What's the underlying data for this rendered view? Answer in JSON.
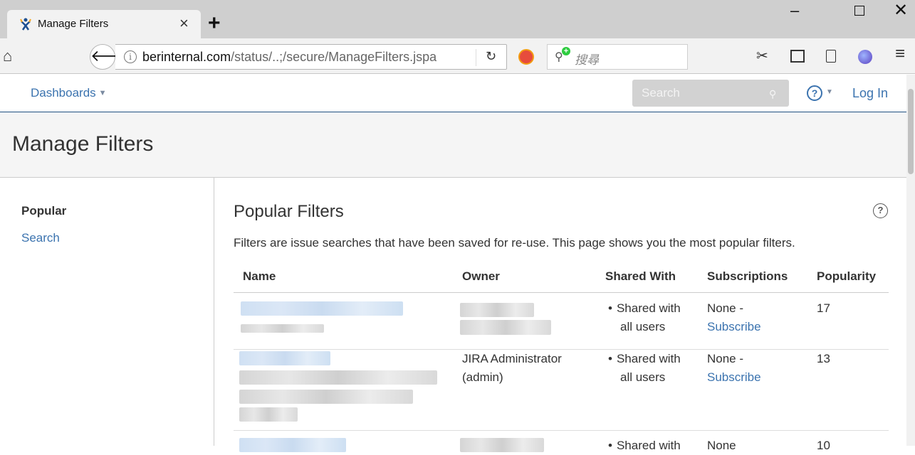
{
  "browser": {
    "tab_title": "Manage Filters",
    "tab_close": "×",
    "new_tab": "+",
    "url_dim_prefix": "",
    "url_domain": "berinternal.com",
    "url_path": "/status/..;/secure/ManageFilters.jspa",
    "search_placeholder": "搜尋",
    "window_min": "–",
    "window_close": "✕"
  },
  "header": {
    "dashboards_label": "Dashboards",
    "search_placeholder": "Search",
    "help_label": "?",
    "login_label": "Log In"
  },
  "page": {
    "title": "Manage Filters"
  },
  "sidebar": {
    "items": [
      {
        "label": "Popular",
        "active": true
      },
      {
        "label": "Search",
        "active": false
      }
    ]
  },
  "main": {
    "title": "Popular Filters",
    "description": "Filters are issue searches that have been saved for re-use. This page shows you the most popular filters.",
    "columns": [
      "Name",
      "Owner",
      "Shared With",
      "Subscriptions",
      "Popularity"
    ],
    "rows": [
      {
        "owner": "",
        "shared_with": [
          "Shared with",
          "all users"
        ],
        "subscriptions_none": "None -",
        "subscribe_link": "Subscribe",
        "popularity": "17"
      },
      {
        "owner_line1": "JIRA Administrator",
        "owner_line2": "(admin)",
        "shared_with": [
          "Shared with",
          "all users"
        ],
        "subscriptions_none": "None -",
        "subscribe_link": "Subscribe",
        "popularity": "13"
      },
      {
        "owner": "",
        "shared_with": [
          "Shared with"
        ],
        "subscriptions_none": "None",
        "popularity": "10"
      }
    ]
  },
  "colors": {
    "link": "#3b73af",
    "header_rule": "#205081",
    "text": "#333333"
  }
}
